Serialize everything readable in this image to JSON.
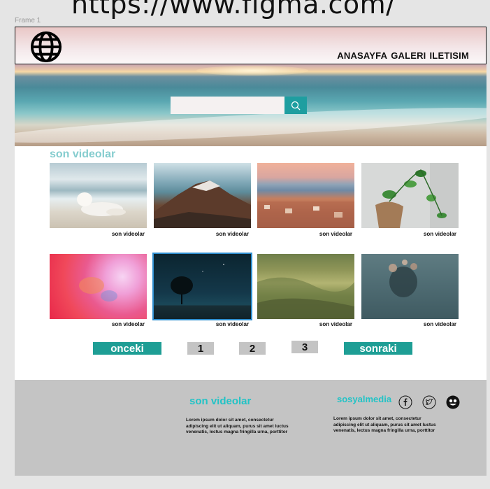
{
  "page": {
    "url_title": "https://www.figma.com/",
    "frame_label": "Frame 1"
  },
  "header": {
    "logo_icon": "globe-icon",
    "nav": [
      "ANASAYFA",
      "GALERI",
      "ILETISIM"
    ]
  },
  "search": {
    "placeholder": "",
    "button_icon": "search-icon"
  },
  "gallery": {
    "title": "son videolar",
    "items": [
      {
        "caption": "son videolar",
        "image": "dog-on-beach"
      },
      {
        "caption": "son videolar",
        "image": "mountain-forest"
      },
      {
        "caption": "son videolar",
        "image": "coastal-city"
      },
      {
        "caption": "son videolar",
        "image": "potted-plant"
      },
      {
        "caption": "son videolar",
        "image": "pink-ink"
      },
      {
        "caption": "son videolar",
        "image": "tree-night"
      },
      {
        "caption": "son videolar",
        "image": "green-hills"
      },
      {
        "caption": "son videolar",
        "image": "flowers-glass"
      }
    ]
  },
  "pagination": {
    "prev": "onceki",
    "pages": [
      "1",
      "2",
      "3"
    ],
    "next": "sonraki"
  },
  "footer": {
    "title": "son videolar",
    "text": "Lorem ipsum dolor sit amet, consectetur adipiscing elit ut aliquam, purus sit amet luctus venenatis, lectus magna fringilla urna, porttitor",
    "social_title": "sosyalmedia",
    "social_text": "Lorem ipsum dolor sit amet, consectetur adipiscing elit ut aliquam, purus sit amet luctus venenatis, lectus magna fringilla urna, porttitor",
    "social_icons": [
      "facebook-icon",
      "twitter-icon",
      "dribbble-icon"
    ]
  },
  "colors": {
    "accent": "#1e9ea0",
    "title_teal": "#86cdcf",
    "footer_bg": "#c4c4c4"
  }
}
